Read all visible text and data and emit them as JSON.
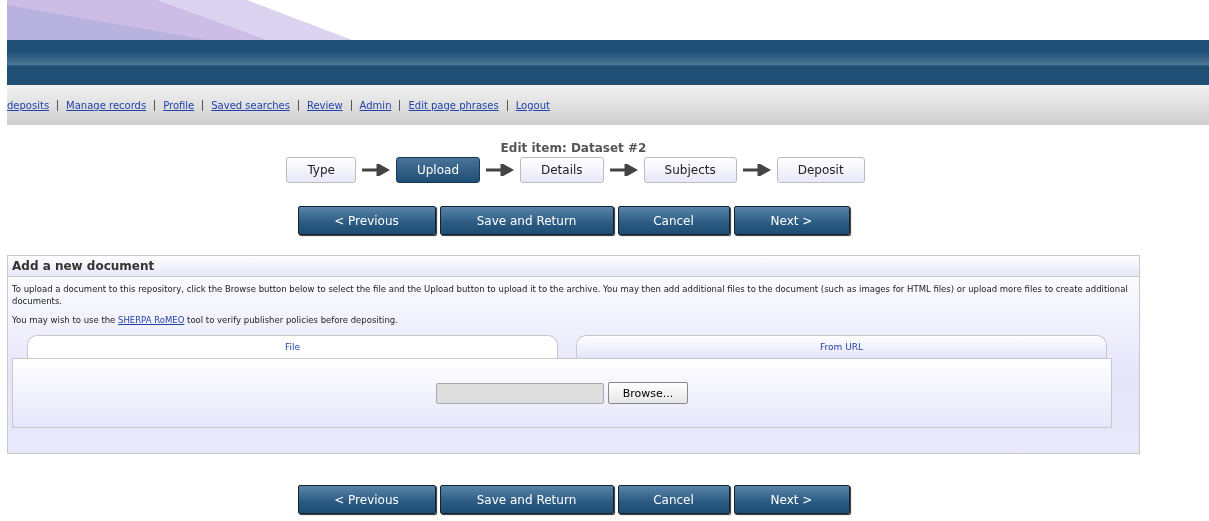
{
  "nav_links": [
    "deposits",
    "Manage records",
    "Profile",
    "Saved searches",
    "Review",
    "Admin",
    "Edit page phrases",
    "Logout"
  ],
  "page_title": "Edit item: Dataset #2",
  "steps": [
    {
      "label": "Type",
      "selected": false
    },
    {
      "label": "Upload",
      "selected": true
    },
    {
      "label": "Details",
      "selected": false
    },
    {
      "label": "Subjects",
      "selected": false
    },
    {
      "label": "Deposit",
      "selected": false
    }
  ],
  "top_buttons": [
    "< Previous",
    "Save and Return",
    "Cancel",
    "Next >"
  ],
  "panel": {
    "title": "Add a new document",
    "intro": "To upload a document to this repository, click the Browse button below to select the file and the Upload button to upload it to the archive. You may then add additional files to the document (such as images for HTML files) or upload more files to create additional documents.",
    "tip_before": "You may wish to use the ",
    "tip_link": "SHERPA RoMEO",
    "tip_after": " tool to verify publisher policies before depositing.",
    "tabs": [
      {
        "label": "File",
        "selected": true
      },
      {
        "label": "From URL",
        "selected": false
      }
    ],
    "browse_button": "Browse..."
  },
  "bottom_buttons": [
    "< Previous",
    "Save and Return",
    "Cancel",
    "Next >"
  ]
}
